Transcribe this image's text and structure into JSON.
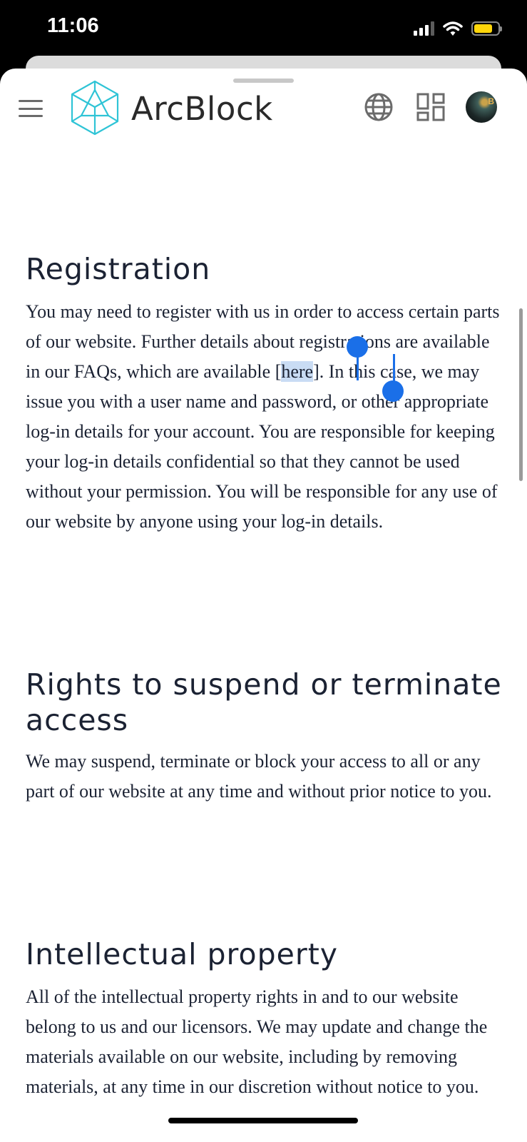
{
  "status_bar": {
    "time": "11:06"
  },
  "header": {
    "brand": "ArcBlock",
    "avatar_badge": "B"
  },
  "sections": [
    {
      "heading": "Registration",
      "body_before": "You may need to register with us in order to access certain parts of our website. Further details about registrations are available in our FAQs, which are available [",
      "selected_text": "here",
      "body_after": "]. In this case, we may issue you with a user name and password, or other appropriate log-in details for your account. You are responsible for keeping your log-in details confidential so that they cannot be used without your permission. You will be responsible for any use of our website by anyone using your log-in details."
    },
    {
      "heading": "Rights to suspend or terminate access",
      "body": "We may suspend, terminate or block your access to all or any part of our website at any time and without prior notice to you."
    },
    {
      "heading": "Intellectual property",
      "body": "All of the intellectual property rights in and to our website belong to us and our licensors. We may update and change the materials available on our website, including by removing materials, at any time in our discretion without notice to you."
    }
  ],
  "colors": {
    "selection": "#c9dcf4",
    "selection_handle": "#1a6fe8",
    "logo": "#2fc4d6",
    "text": "#1b2233"
  },
  "icons": [
    "menu-icon",
    "globe-icon",
    "apps-icon",
    "wifi-icon",
    "signal-icon",
    "battery-icon"
  ]
}
